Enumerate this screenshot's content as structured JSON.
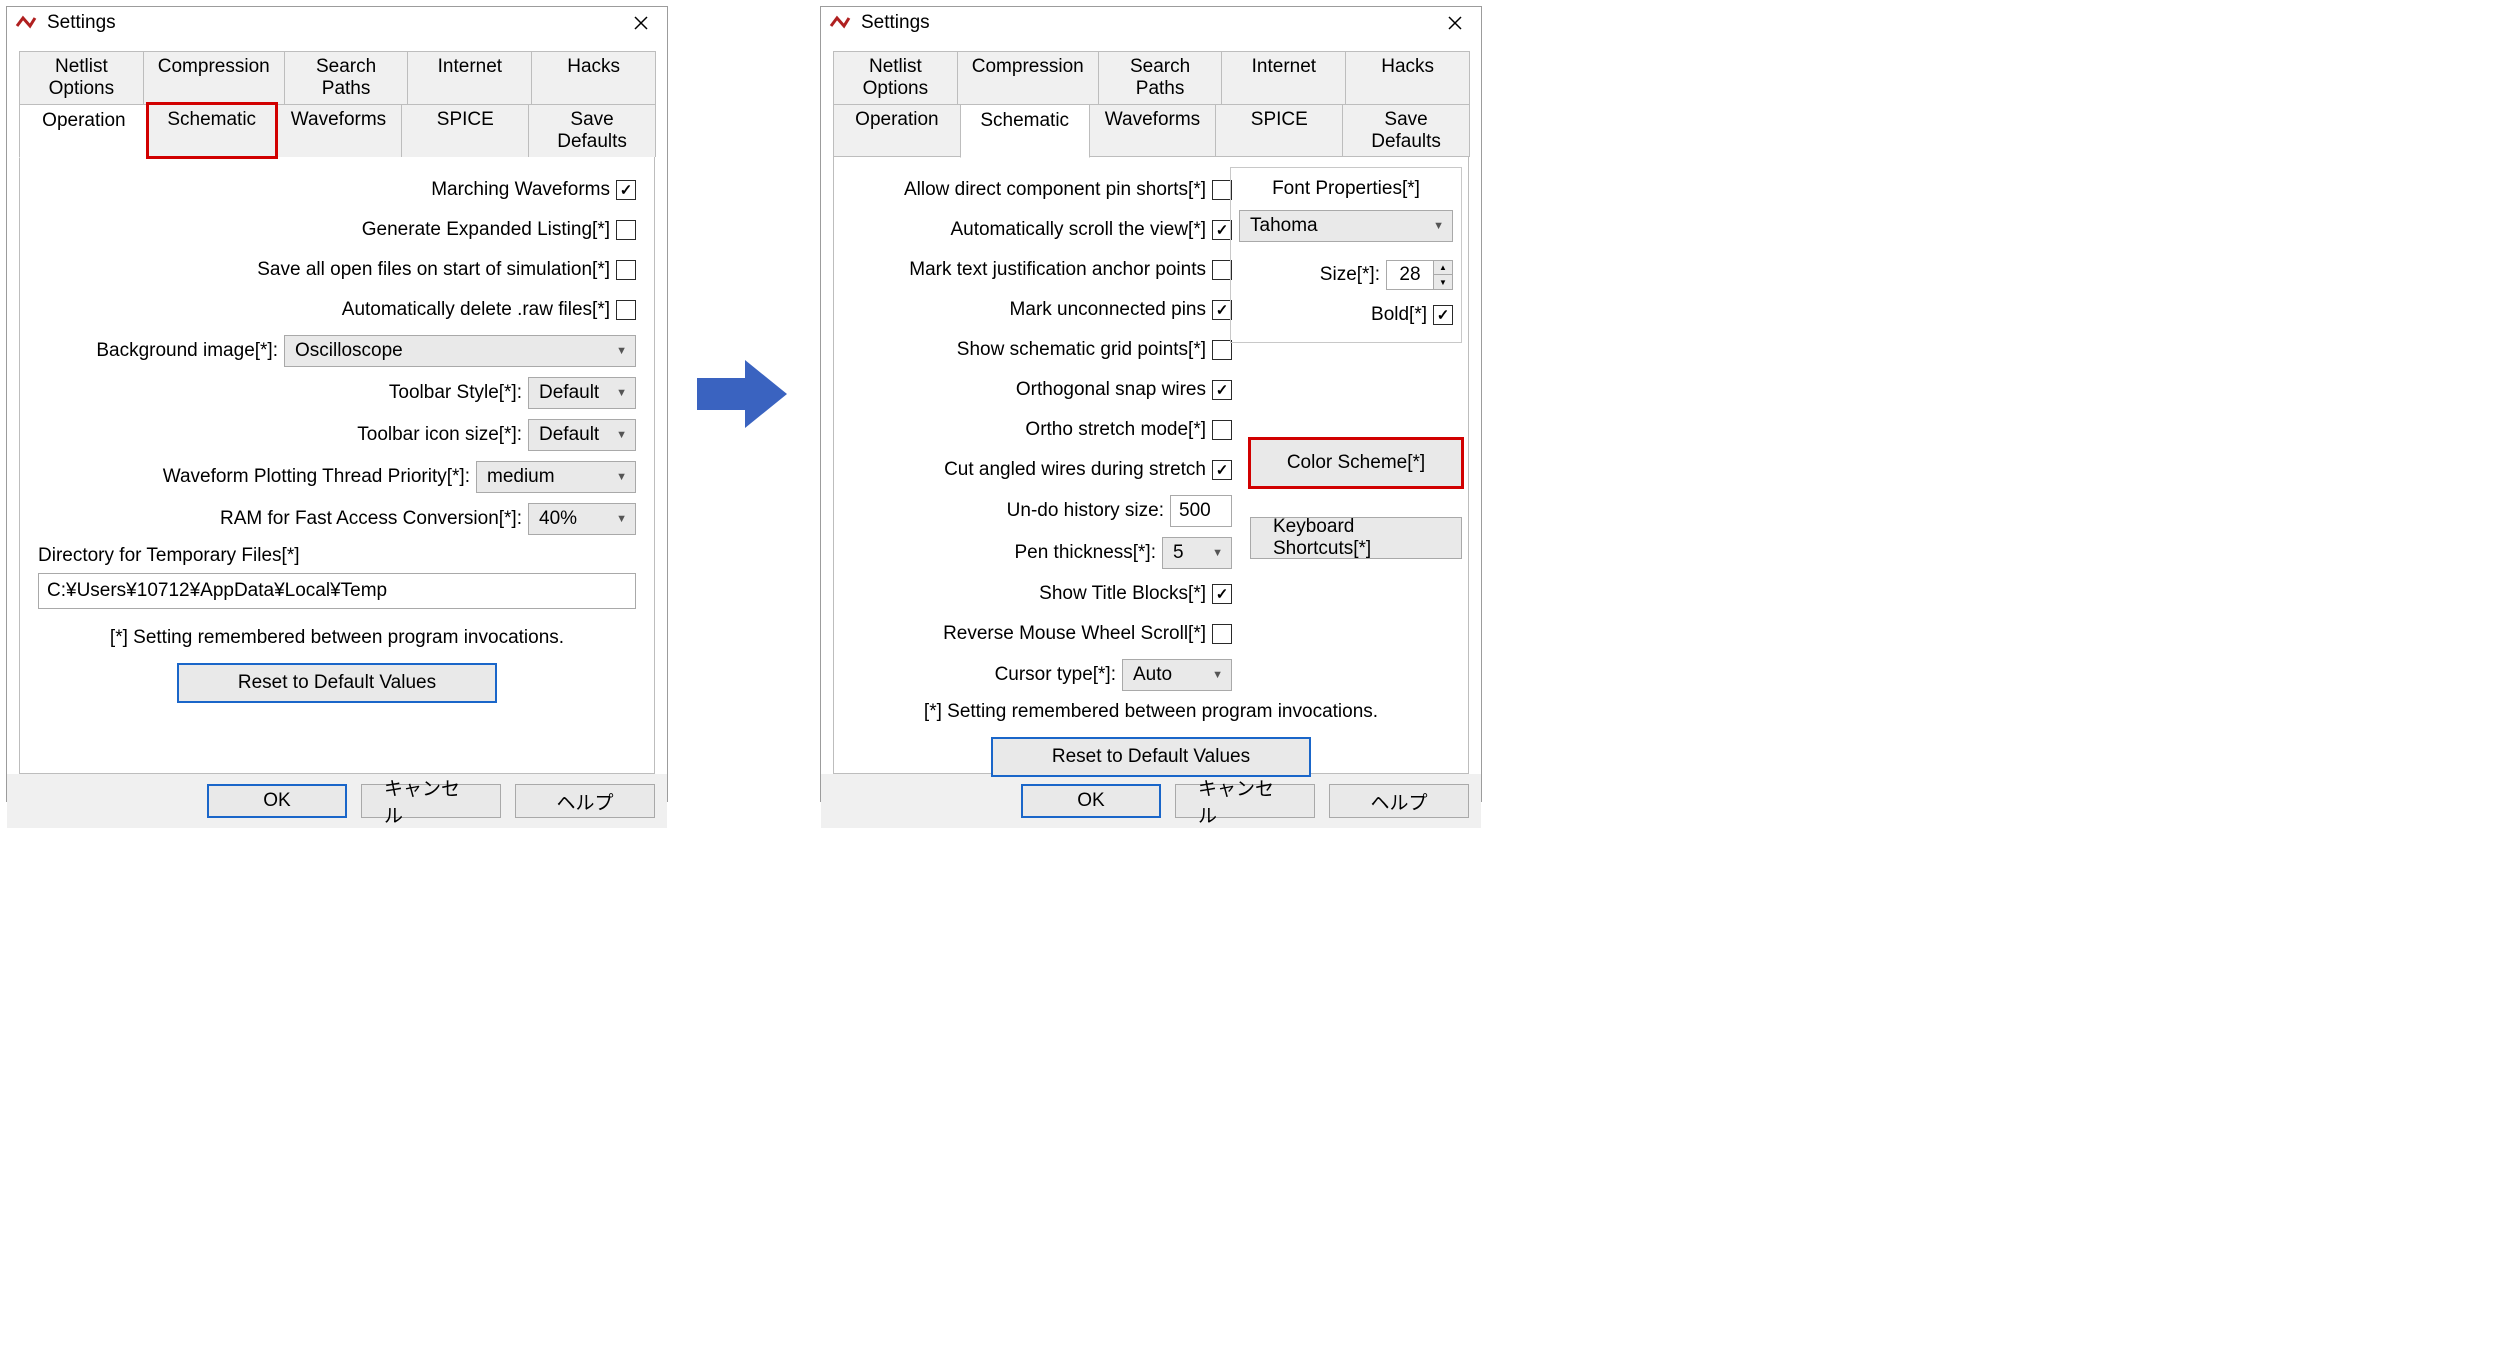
{
  "common": {
    "windowTitle": "Settings",
    "tabsTop": [
      "Netlist Options",
      "Compression",
      "Search Paths",
      "Internet",
      "Hacks"
    ],
    "tabsBottom": [
      "Operation",
      "Schematic",
      "Waveforms",
      "SPICE",
      "Save Defaults"
    ],
    "note": "[*] Setting remembered between program invocations.",
    "resetLabel": "Reset to Default Values",
    "okLabel": "OK",
    "cancelLabel": "キャンセル",
    "helpLabel": "ヘルプ"
  },
  "left": {
    "activeTab": "Operation",
    "highlightTab": "Schematic",
    "rows": {
      "marchingWaveforms": "Marching Waveforms",
      "generateExpanded": "Generate Expanded Listing[*]",
      "saveAllOpen": "Save all open files on start of simulation[*]",
      "autoDeleteRaw": "Automatically delete .raw files[*]",
      "backgroundImage": "Background image[*]:",
      "backgroundImageValue": "Oscilloscope",
      "toolbarStyle": "Toolbar Style[*]:",
      "toolbarStyleValue": "Default",
      "toolbarIconSize": "Toolbar icon size[*]:",
      "toolbarIconSizeValue": "Default",
      "threadPriority": "Waveform Plotting Thread Priority[*]:",
      "threadPriorityValue": "medium",
      "ramConversion": "RAM for Fast Access Conversion[*]:",
      "ramConversionValue": "40%",
      "tempDirLabel": "Directory for Temporary Files[*]",
      "tempDirValue": "C:¥Users¥10712¥AppData¥Local¥Temp"
    }
  },
  "right": {
    "activeTab": "Schematic",
    "rows": {
      "allowPinShorts": "Allow direct component pin shorts[*]",
      "autoScroll": "Automatically scroll the view[*]",
      "markAnchor": "Mark text justification anchor points",
      "markUnconnected": "Mark unconnected pins",
      "showGrid": "Show schematic grid points[*]",
      "orthoSnap": "Orthogonal snap wires",
      "orthoStretch": "Ortho stretch mode[*]",
      "cutAngled": "Cut angled wires during stretch",
      "undoSize": "Un-do history size:",
      "undoSizeValue": "500",
      "penThickness": "Pen thickness[*]:",
      "penThicknessValue": "5",
      "showTitleBlocks": "Show Title Blocks[*]",
      "reverseWheel": "Reverse Mouse Wheel Scroll[*]",
      "cursorType": "Cursor type[*]:",
      "cursorTypeValue": "Auto"
    },
    "fontBox": {
      "title": "Font Properties[*]",
      "fontName": "Tahoma",
      "sizeLabel": "Size[*]:",
      "sizeValue": "28",
      "boldLabel": "Bold[*]"
    },
    "colorSchemeLabel": "Color Scheme[*]",
    "keyboardShortcutsLabel": "Keyboard Shortcuts[*]"
  }
}
